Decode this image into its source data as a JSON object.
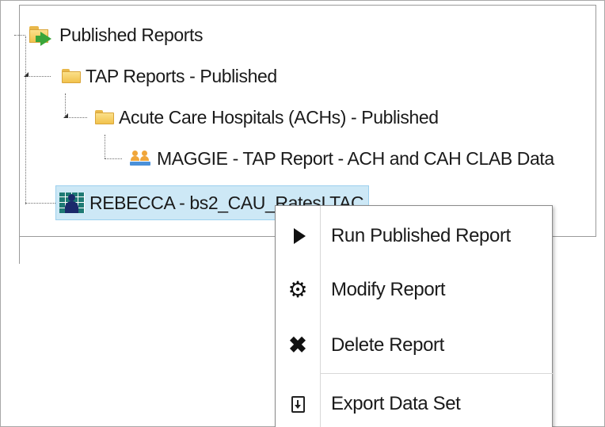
{
  "tree": {
    "root": {
      "label": "Published Reports",
      "icon": "published-folder-icon"
    },
    "tap_folder": {
      "label": "TAP Reports - Published",
      "icon": "folder-icon"
    },
    "ach_folder": {
      "label": "Acute Care Hospitals (ACHs) - Published",
      "icon": "folder-icon"
    },
    "maggie_report": {
      "label": "MAGGIE - TAP Report - ACH and CAH CLAB Data",
      "icon": "people-icon"
    },
    "rebecca_report": {
      "label": "REBECCA - bs2_CAU_RatesLTAC",
      "icon": "dataset-icon",
      "selected": true
    }
  },
  "context_menu": {
    "items": [
      {
        "label": "Run Published Report",
        "icon": "play-icon"
      },
      {
        "label": "Modify Report",
        "icon": "gear-icon"
      },
      {
        "label": "Delete Report",
        "icon": "close-icon"
      },
      {
        "label": "Export Data Set",
        "icon": "export-icon"
      }
    ]
  },
  "colors": {
    "selection_background": "#cde8f6",
    "folder": "#f1c24d",
    "publish_arrow": "#3aa53a"
  }
}
